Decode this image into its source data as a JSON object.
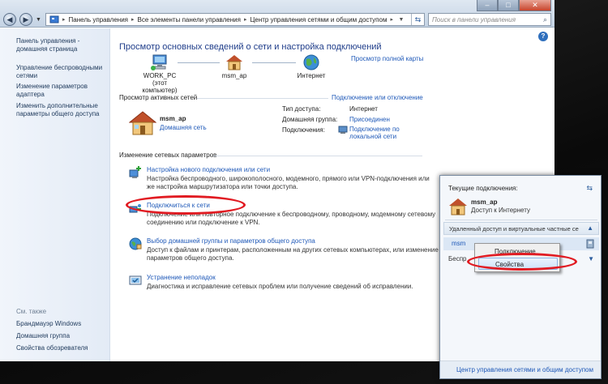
{
  "window": {
    "back_icon": "back-arrow-icon",
    "forward_icon": "forward-arrow-icon",
    "breadcrumb": [
      "Панель управления",
      "Все элементы панели управления",
      "Центр управления сетями и общим доступом"
    ],
    "search_placeholder": "Поиск в панели управления",
    "controls": {
      "minimize": "–",
      "maximize": "□",
      "close": "✕"
    }
  },
  "sidebar": {
    "links": [
      "Панель управления - домашняя страница",
      "Управление беспроводными сетями",
      "Изменение параметров адаптера",
      "Изменить дополнительные параметры общего доступа"
    ],
    "see_also_heading": "См. также",
    "see_also": [
      "Брандмауэр Windows",
      "Домашняя группа",
      "Свойства обозревателя"
    ]
  },
  "main": {
    "title": "Просмотр основных сведений о сети и настройка подключений",
    "full_map_link": "Просмотр полной карты",
    "nodes": [
      {
        "label": "WORK_PC",
        "sublabel": "(этот компьютер)"
      },
      {
        "label": "msm_ap",
        "sublabel": ""
      },
      {
        "label": "Интернет",
        "sublabel": ""
      }
    ],
    "active_heading": "Просмотр активных сетей",
    "connect_disconnect_link": "Подключение или отключение",
    "active_network": {
      "name": "msm_ap",
      "type": "Домашняя сеть",
      "access_type_label": "Тип доступа:",
      "access_type_value": "Интернет",
      "homegroup_label": "Домашняя группа:",
      "homegroup_value": "Присоединен",
      "connections_label": "Подключения:",
      "connections_value": "Подключение по локальной сети"
    },
    "change_heading": "Изменение сетевых параметров",
    "tasks": [
      {
        "title": "Настройка нового подключения или сети",
        "desc": "Настройка беспроводного, широкополосного, модемного, прямого или VPN-подключения или же настройка маршрутизатора или точки доступа."
      },
      {
        "title": "Подключиться к сети",
        "desc": "Подключение или повторное подключение к беспроводному, проводному, модемному сетевому соединению или подключение к VPN."
      },
      {
        "title": "Выбор домашней группы и параметров общего доступа",
        "desc": "Доступ к файлам и принтерам, расположенным на других сетевых компьютерах, или изменение параметров общего доступа."
      },
      {
        "title": "Устранение неполадок",
        "desc": "Диагностика и исправление сетевых проблем или получение сведений об исправлении."
      }
    ]
  },
  "flyout": {
    "heading": "Текущие подключения:",
    "network_name": "msm_ap",
    "network_status": "Доступ к Интернету",
    "vpn_band": "Удаленный доступ и виртуальные частные се",
    "vpn_item": "msm",
    "wireless_band_partial": "Беспр",
    "footer_link": "Центр управления сетями и общим доступом"
  },
  "context_menu": {
    "items": [
      "Подключение",
      "Свойства"
    ],
    "selected": "Свойства"
  },
  "colors": {
    "link": "#1e58b8",
    "title": "#1f3d8a",
    "highlight": "#e11b22"
  }
}
